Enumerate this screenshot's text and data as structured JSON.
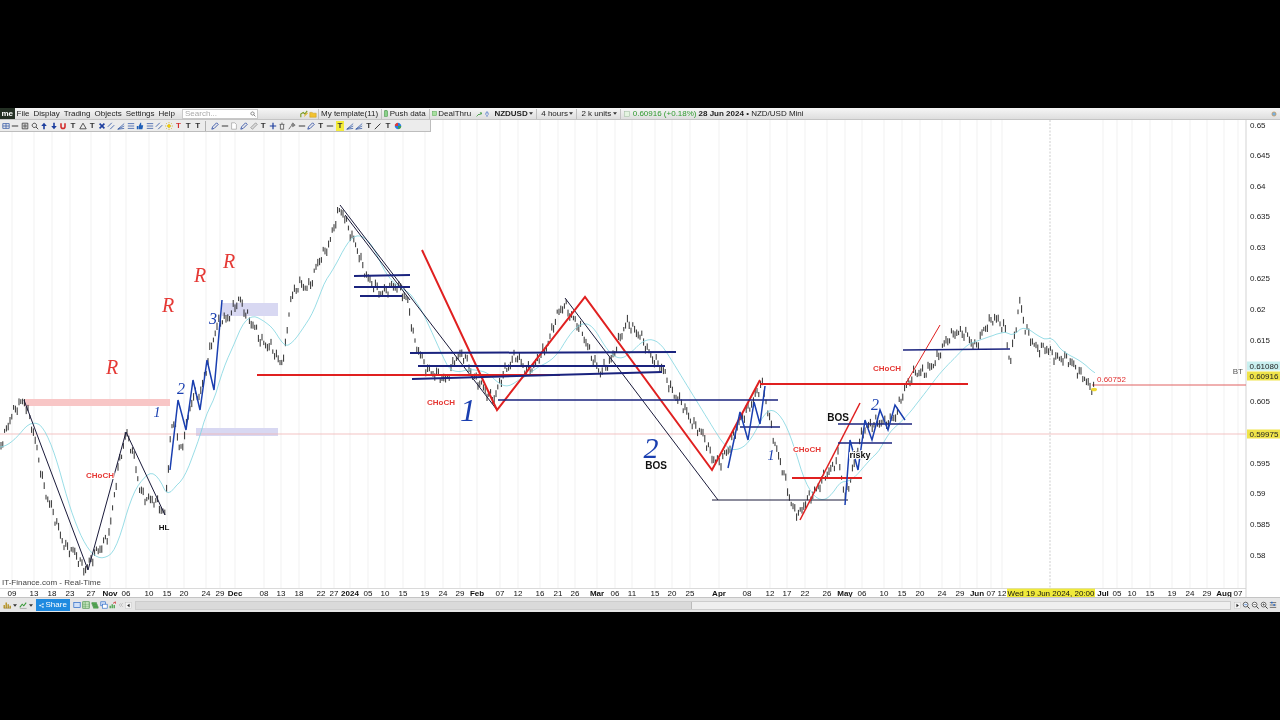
{
  "menu_bar": {
    "logo": "me",
    "items": [
      "File",
      "Display",
      "Trading",
      "Objects",
      "Settings",
      "Help"
    ],
    "search": {
      "placeholder": "Search..."
    },
    "template_button": "My template(11)",
    "push_data": "Push data",
    "deal_thru": "DealThru"
  },
  "instrument_bar": {
    "symbol": "NZDUSD",
    "timeframe": "4 hours",
    "size": "2 k units",
    "quote": "0.60916 (+0.18%)",
    "description": "**28 Jun 2024** • NZD/USD Mini"
  },
  "tool_groups": [
    {
      "tools": [
        {
          "kind": "grid"
        },
        {
          "kind": "line"
        },
        {
          "kind": "frame"
        },
        {
          "kind": "zoom"
        },
        {
          "kind": "up"
        },
        {
          "kind": "down"
        },
        {
          "kind": "magnet"
        },
        {
          "kind": "text",
          "label": "T"
        },
        {
          "kind": "triangle"
        },
        {
          "kind": "text",
          "label": "T"
        },
        {
          "kind": "cross"
        },
        {
          "kind": "channel"
        },
        {
          "kind": "fan"
        },
        {
          "kind": "levels"
        },
        {
          "kind": "thumb"
        },
        {
          "kind": "levels"
        },
        {
          "kind": "channel"
        },
        {
          "kind": "sun"
        },
        {
          "kind": "text",
          "label": "T",
          "color": "#d32f2f"
        },
        {
          "kind": "text",
          "label": "T"
        },
        {
          "kind": "text",
          "label": "T"
        }
      ]
    },
    {
      "tools": [
        {
          "kind": "pencil"
        },
        {
          "kind": "line"
        },
        {
          "kind": "page"
        },
        {
          "kind": "pencil"
        },
        {
          "kind": "ruler"
        },
        {
          "kind": "text",
          "label": "T"
        },
        {
          "kind": "crosshair"
        },
        {
          "kind": "trash"
        },
        {
          "kind": "brush"
        },
        {
          "kind": "line"
        },
        {
          "kind": "pencil"
        },
        {
          "kind": "text",
          "label": "T"
        },
        {
          "kind": "line"
        },
        {
          "kind": "marker",
          "label": "T"
        },
        {
          "kind": "fan"
        },
        {
          "kind": "fan"
        },
        {
          "kind": "text",
          "label": "T"
        },
        {
          "kind": "pen"
        },
        {
          "kind": "text",
          "label": "T"
        },
        {
          "kind": "globe"
        }
      ]
    }
  ],
  "chart": {
    "price_axis": [
      "0.65",
      "0.645",
      "0.64",
      "0.635",
      "0.63",
      "0.625",
      "0.62",
      "0.615",
      "0.605",
      "0.595",
      "0.59",
      "0.585",
      "0.58"
    ],
    "price_tags": [
      {
        "text": "0.61080",
        "color": "#c9f0f0"
      },
      {
        "text": "0.60916",
        "color": "#f0e44a"
      },
      {
        "text": "0.59975",
        "color": "#f0e44a"
      }
    ],
    "tag_note": "BT",
    "last_price_label": "0.60752",
    "time_axis": [
      {
        "label": "09",
        "major": false
      },
      {
        "label": "13",
        "major": false
      },
      {
        "label": "18",
        "major": false
      },
      {
        "label": "23",
        "major": false
      },
      {
        "label": "27",
        "major": false
      },
      {
        "label": "Nov",
        "major": true
      },
      {
        "label": "06",
        "major": false
      },
      {
        "label": "10",
        "major": false
      },
      {
        "label": "15",
        "major": false
      },
      {
        "label": "20",
        "major": false
      },
      {
        "label": "24",
        "major": false
      },
      {
        "label": "29",
        "major": false
      },
      {
        "label": "Dec",
        "major": true
      },
      {
        "label": "08",
        "major": false
      },
      {
        "label": "13",
        "major": false
      },
      {
        "label": "18",
        "major": false
      },
      {
        "label": "22",
        "major": false
      },
      {
        "label": "27",
        "major": false
      },
      {
        "label": "2024",
        "major": true
      },
      {
        "label": "05",
        "major": false
      },
      {
        "label": "10",
        "major": false
      },
      {
        "label": "15",
        "major": false
      },
      {
        "label": "19",
        "major": false
      },
      {
        "label": "24",
        "major": false
      },
      {
        "label": "29",
        "major": false
      },
      {
        "label": "Feb",
        "major": true
      },
      {
        "label": "07",
        "major": false
      },
      {
        "label": "12",
        "major": false
      },
      {
        "label": "16",
        "major": false
      },
      {
        "label": "21",
        "major": false
      },
      {
        "label": "26",
        "major": false
      },
      {
        "label": "Mar",
        "major": true
      },
      {
        "label": "06",
        "major": false
      },
      {
        "label": "11",
        "major": false
      },
      {
        "label": "15",
        "major": false
      },
      {
        "label": "20",
        "major": false
      },
      {
        "label": "25",
        "major": false
      },
      {
        "label": "Apr",
        "major": true
      },
      {
        "label": "08",
        "major": false
      },
      {
        "label": "12",
        "major": false
      },
      {
        "label": "17",
        "major": false
      },
      {
        "label": "22",
        "major": false
      },
      {
        "label": "26",
        "major": false
      },
      {
        "label": "May",
        "major": true
      },
      {
        "label": "06",
        "major": false
      },
      {
        "label": "10",
        "major": false
      },
      {
        "label": "15",
        "major": false
      },
      {
        "label": "20",
        "major": false
      },
      {
        "label": "24",
        "major": false
      },
      {
        "label": "29",
        "major": false
      },
      {
        "label": "Jun",
        "major": true
      },
      {
        "label": "07",
        "major": false
      },
      {
        "label": "12",
        "major": false
      },
      {
        "label": "Jul",
        "major": true
      },
      {
        "label": "05",
        "major": false
      },
      {
        "label": "10",
        "major": false
      },
      {
        "label": "15",
        "major": false
      },
      {
        "label": "19",
        "major": false
      },
      {
        "label": "24",
        "major": false
      },
      {
        "label": "29",
        "major": false
      },
      {
        "label": "Aug",
        "major": true
      },
      {
        "label": "07",
        "major": false
      }
    ],
    "cursor_time": "Wed 19 Jun 2024, 20:00",
    "annotations": [
      {
        "kind": "handwritten",
        "text": "R",
        "color": "#e53935"
      },
      {
        "kind": "handwritten",
        "text": "R",
        "color": "#e53935"
      },
      {
        "kind": "handwritten",
        "text": "R",
        "color": "#e53935"
      },
      {
        "kind": "handwritten",
        "text": "R",
        "color": "#e53935"
      },
      {
        "kind": "handwritten",
        "text": "3",
        "color": "#1a3fb0"
      },
      {
        "kind": "handwritten",
        "text": "2",
        "color": "#1a3fb0"
      },
      {
        "kind": "handwritten",
        "text": "1",
        "color": "#1a3fb0"
      },
      {
        "kind": "label",
        "text": "CHoCH",
        "color": "#e53935"
      },
      {
        "kind": "label",
        "text": "HL",
        "color": "#111111"
      },
      {
        "kind": "label",
        "text": "CHoCH",
        "color": "#e53935"
      },
      {
        "kind": "handwritten",
        "text": "1",
        "color": "#1a3fb0"
      },
      {
        "kind": "handwritten",
        "text": "2",
        "color": "#1a3fb0"
      },
      {
        "kind": "label",
        "text": "BOS",
        "color": "#111111"
      },
      {
        "kind": "handwritten",
        "text": "1",
        "color": "#1a3fb0"
      },
      {
        "kind": "label",
        "text": "CHoCH",
        "color": "#e53935"
      },
      {
        "kind": "label",
        "text": "BOS",
        "color": "#111111"
      },
      {
        "kind": "handwritten",
        "text": "2",
        "color": "#1a3fb0"
      },
      {
        "kind": "label",
        "text": "risky",
        "color": "#111111"
      },
      {
        "kind": "label",
        "text": "CHoCH",
        "color": "#e53935"
      }
    ],
    "source": "IT-Finance.com - Real-Time"
  },
  "bottom_bar": {
    "share_button": "Share"
  }
}
